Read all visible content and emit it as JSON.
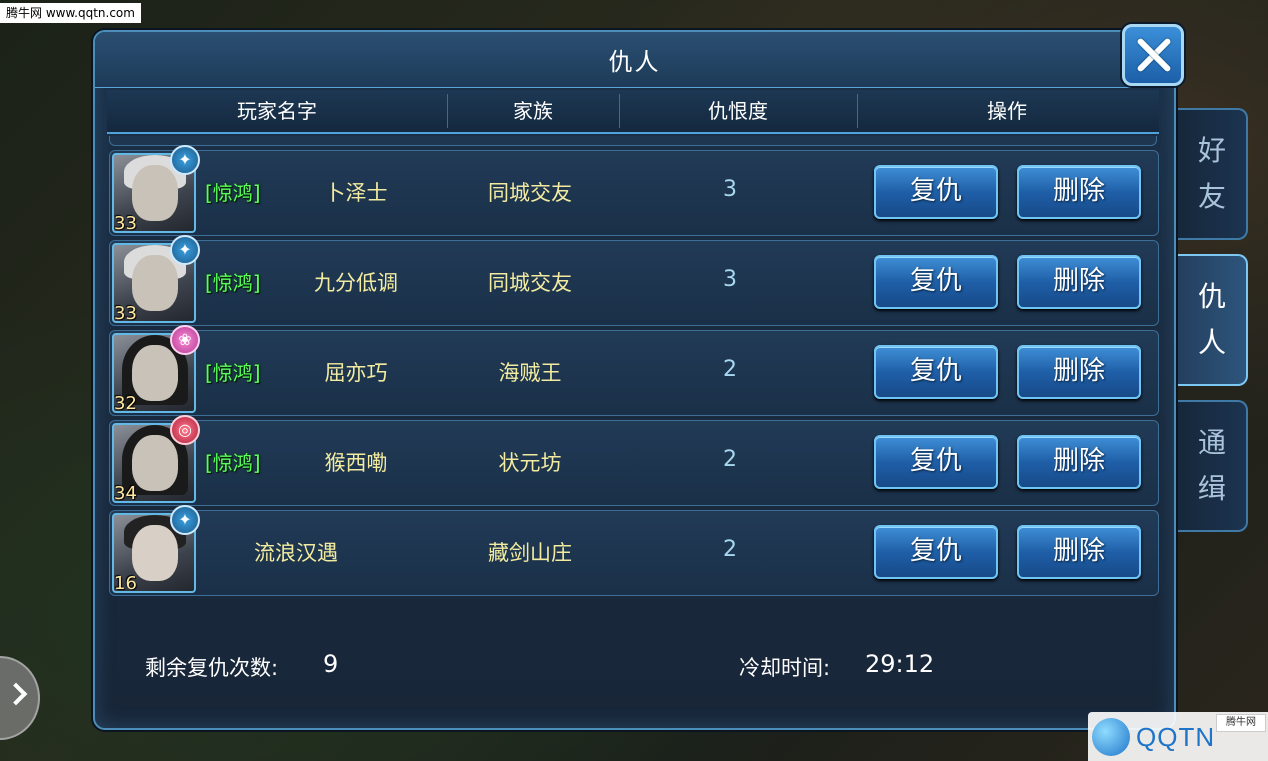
{
  "watermark": {
    "top": "腾牛网 www.qqtn.com",
    "logo": "QQTN",
    "logo_small": "腾牛网",
    "logo_domain": ".com"
  },
  "dialog": {
    "title": "仇人"
  },
  "columns": {
    "player": "玩家名字",
    "family": "家族",
    "hate": "仇恨度",
    "action": "操作"
  },
  "rows": [
    {
      "guild": "[惊鸿]",
      "name": "卜泽士",
      "family": "同城交友",
      "hate": "3",
      "level": "33",
      "revenge": "复仇",
      "delete": "删除"
    },
    {
      "guild": "[惊鸿]",
      "name": "九分低调",
      "family": "同城交友",
      "hate": "3",
      "level": "33",
      "revenge": "复仇",
      "delete": "删除"
    },
    {
      "guild": "[惊鸿]",
      "name": "屈亦巧",
      "family": "海贼王",
      "hate": "2",
      "level": "32",
      "revenge": "复仇",
      "delete": "删除"
    },
    {
      "guild": "[惊鸿]",
      "name": "猴西嘞",
      "family": "状元坊",
      "hate": "2",
      "level": "34",
      "revenge": "复仇",
      "delete": "删除"
    },
    {
      "guild": "",
      "name": "流浪汉遇",
      "family": "藏剑山庄",
      "hate": "2",
      "level": "16",
      "revenge": "复仇",
      "delete": "删除"
    }
  ],
  "footer": {
    "remaining_label": "剩余复仇次数:",
    "remaining_value": "9",
    "cooldown_label": "冷却时间:",
    "cooldown_value": "29:12"
  },
  "side_tabs": [
    {
      "chars": [
        "好",
        "友"
      ]
    },
    {
      "chars": [
        "仇",
        "人"
      ]
    },
    {
      "chars": [
        "通",
        "缉"
      ]
    }
  ],
  "icons": {
    "close": "close-x-icon",
    "expand": "chevron-right-icon"
  },
  "colors": {
    "guild_tag": "#5dff5d",
    "name": "#f3eca0",
    "hate": "#a8d8f0",
    "accent": "#4b8fb8"
  }
}
